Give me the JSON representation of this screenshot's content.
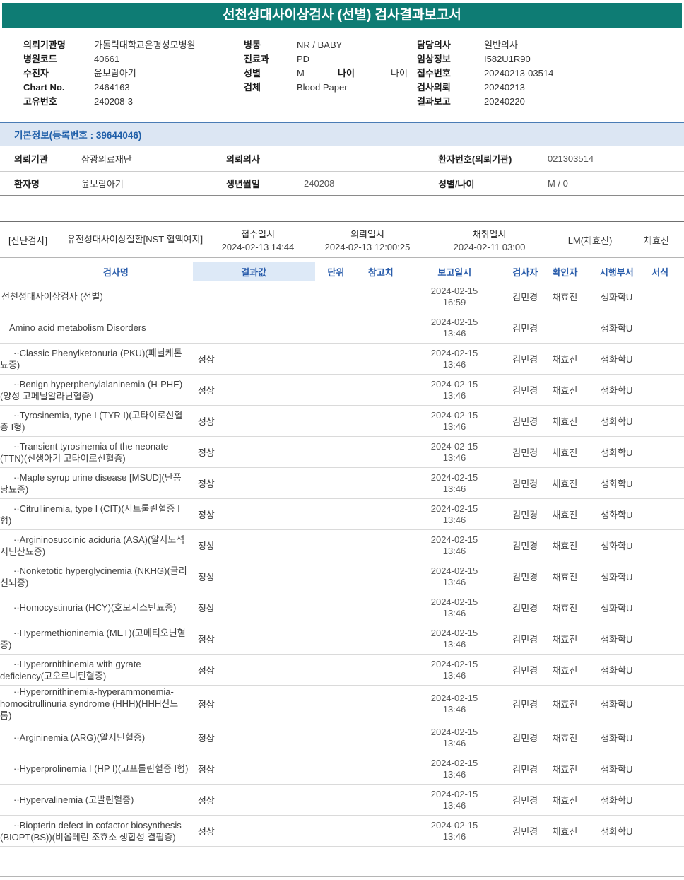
{
  "report": {
    "title": "선천성대사이상검사 (선별) 검사결과보고서"
  },
  "colors": {
    "header_bg": "#0e7c74",
    "accent_blue": "#2a5dab",
    "info_bar_bg": "#dce6f3",
    "info_bar_text": "#1f5fa9"
  },
  "meta": {
    "left": [
      {
        "label": "의뢰기관명",
        "value": "가톨릭대학교은평성모병원"
      },
      {
        "label": "병원코드",
        "value": "40661"
      },
      {
        "label": "수진자",
        "value": "윤보람아기"
      },
      {
        "label": "Chart No.",
        "value": "2464163"
      },
      {
        "label": "고유번호",
        "value": "240208-3"
      }
    ],
    "middle": [
      {
        "label": "병동",
        "value": "NR / BABY"
      },
      {
        "label": "진료과",
        "value": "PD"
      },
      {
        "label": "성별",
        "value": "M",
        "label2": "나이",
        "value2": "나이"
      },
      {
        "label": "검체",
        "value": "Blood Paper"
      }
    ],
    "right": [
      {
        "label": "담당의사",
        "value": "일반의사"
      },
      {
        "label": "임상정보",
        "value": "I582U1R90"
      },
      {
        "label": "접수번호",
        "value": "20240213-03514"
      },
      {
        "label": "검사의뢰",
        "value": "20240213"
      },
      {
        "label": "결과보고",
        "value": "20240220"
      }
    ]
  },
  "basic_info": {
    "bar_title": "기본정보(등록번호 : 39644046)",
    "row1": {
      "label1": "의뢰기관",
      "value1": "삼광의료재단",
      "label2": "의뢰의사",
      "value2": "",
      "label3": "환자번호(의뢰기관)",
      "value3": "021303514"
    },
    "row2": {
      "label1": "환자명",
      "value1": "윤보람아기",
      "label2": "생년월일",
      "value2": "240208",
      "label3": "성별/나이",
      "value3": "M / 0"
    }
  },
  "order": {
    "section_label": "[진단검사]",
    "group_name": "유전성대사이상질환[NST 혈액여지]",
    "received_label": "접수일시",
    "received_value": "2024-02-13 14:44",
    "requested_label": "의뢰일시",
    "requested_value": "2024-02-13 12:00:25",
    "collected_label": "채취일시",
    "collected_value": "2024-02-11 03:00",
    "lm": "LM(채효진)",
    "collector": "채효진"
  },
  "results": {
    "headers": {
      "name": "검사명",
      "result": "결과값",
      "unit": "단위",
      "ref": "참고치",
      "reported": "보고일시",
      "tester": "검사자",
      "confirmer": "확인자",
      "dept": "시행부서",
      "format": "서식"
    },
    "rows": [
      {
        "level": 0,
        "name": "선천성대사이상검사 (선별)",
        "result": "",
        "reported": "2024-02-15\n16:59",
        "tester": "김민경",
        "confirmer": "채효진",
        "dept": "생화학U"
      },
      {
        "level": 1,
        "name": "Amino acid metabolism Disorders",
        "result": "",
        "reported": "2024-02-15\n13:46",
        "tester": "김민경",
        "confirmer": "",
        "dept": "생화학U"
      },
      {
        "level": 2,
        "name": "··Classic Phenylketonuria (PKU)(페닐케톤뇨증)",
        "result": "정상",
        "reported": "2024-02-15\n13:46",
        "tester": "김민경",
        "confirmer": "채효진",
        "dept": "생화학U"
      },
      {
        "level": 2,
        "name": "··Benign hyperphenylalaninemia (H-PHE)(양성 고페닐알라닌혈증)",
        "result": "정상",
        "reported": "2024-02-15\n13:46",
        "tester": "김민경",
        "confirmer": "채효진",
        "dept": "생화학U"
      },
      {
        "level": 2,
        "name": "··Tyrosinemia, type I (TYR I)(고타이로신혈증 I형)",
        "result": "정상",
        "reported": "2024-02-15\n13:46",
        "tester": "김민경",
        "confirmer": "채효진",
        "dept": "생화학U"
      },
      {
        "level": 2,
        "name": "··Transient tyrosinemia of the neonate (TTN)(신생아기 고타이로신혈증)",
        "result": "정상",
        "reported": "2024-02-15\n13:46",
        "tester": "김민경",
        "confirmer": "채효진",
        "dept": "생화학U"
      },
      {
        "level": 2,
        "name": "··Maple syrup urine disease [MSUD](단풍당뇨증)",
        "result": "정상",
        "reported": "2024-02-15\n13:46",
        "tester": "김민경",
        "confirmer": "채효진",
        "dept": "생화학U"
      },
      {
        "level": 2,
        "name": "··Citrullinemia, type I (CIT)(시트룰린혈증 I형)",
        "result": "정상",
        "reported": "2024-02-15\n13:46",
        "tester": "김민경",
        "confirmer": "채효진",
        "dept": "생화학U"
      },
      {
        "level": 2,
        "name": "··Argininosuccinic aciduria (ASA)(알지노석시닌산뇨증)",
        "result": "정상",
        "reported": "2024-02-15\n13:46",
        "tester": "김민경",
        "confirmer": "채효진",
        "dept": "생화학U"
      },
      {
        "level": 2,
        "name": "··Nonketotic hyperglycinemia (NKHG)(글리신뇌증)",
        "result": "정상",
        "reported": "2024-02-15\n13:46",
        "tester": "김민경",
        "confirmer": "채효진",
        "dept": "생화학U"
      },
      {
        "level": 2,
        "name": "··Homocystinuria (HCY)(호모시스틴뇨증)",
        "result": "정상",
        "reported": "2024-02-15\n13:46",
        "tester": "김민경",
        "confirmer": "채효진",
        "dept": "생화학U"
      },
      {
        "level": 2,
        "name": "··Hypermethioninemia (MET)(고메티오닌혈증)",
        "result": "정상",
        "reported": "2024-02-15\n13:46",
        "tester": "김민경",
        "confirmer": "채효진",
        "dept": "생화학U"
      },
      {
        "level": 2,
        "name": "··Hyperornithinemia with gyrate deficiency(고오르니틴혈증)",
        "result": "정상",
        "reported": "2024-02-15\n13:46",
        "tester": "김민경",
        "confirmer": "채효진",
        "dept": "생화학U"
      },
      {
        "level": 2,
        "name": "··Hyperornithinemia-hyperammonemia-homocitrullinuria syndrome (HHH)(HHH신드롬)",
        "result": "정상",
        "reported": "2024-02-15\n13:46",
        "tester": "김민경",
        "confirmer": "채효진",
        "dept": "생화학U"
      },
      {
        "level": 2,
        "name": "··Argininemia (ARG)(알지닌혈증)",
        "result": "정상",
        "reported": "2024-02-15\n13:46",
        "tester": "김민경",
        "confirmer": "채효진",
        "dept": "생화학U"
      },
      {
        "level": 2,
        "name": "··Hyperprolinemia I (HP I)(고프롤린혈증 I형)",
        "result": "정상",
        "reported": "2024-02-15\n13:46",
        "tester": "김민경",
        "confirmer": "채효진",
        "dept": "생화학U"
      },
      {
        "level": 2,
        "name": "··Hypervalinemia (고발린혈증)",
        "result": "정상",
        "reported": "2024-02-15\n13:46",
        "tester": "김민경",
        "confirmer": "채효진",
        "dept": "생화학U"
      },
      {
        "level": 2,
        "name": "··Biopterin defect in cofactor biosynthesis (BIOPT(BS))(비옵테린 조효소 생합성 결핍증)",
        "result": "정상",
        "reported": "2024-02-15\n13:46",
        "tester": "김민경",
        "confirmer": "채효진",
        "dept": "생화학U"
      }
    ]
  }
}
